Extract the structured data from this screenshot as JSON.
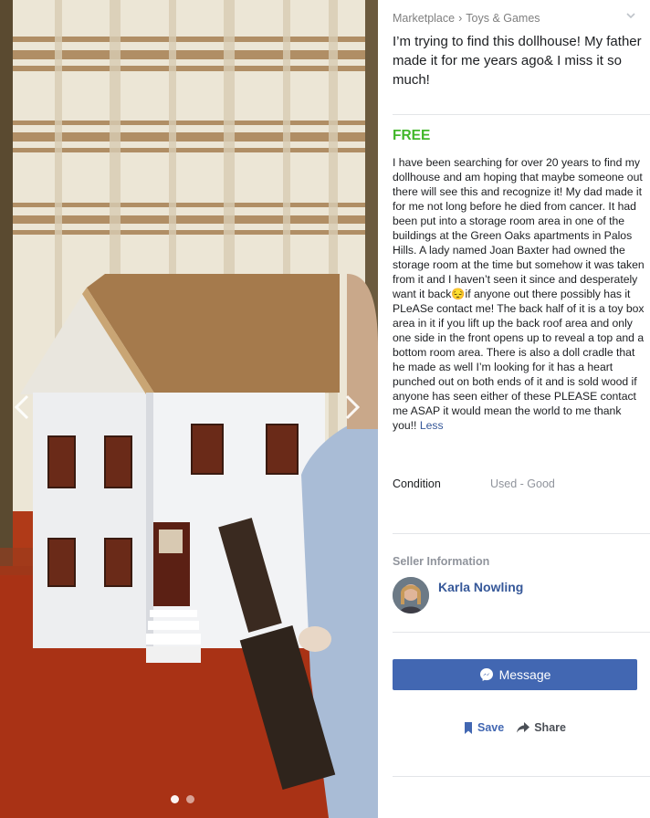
{
  "breadcrumb": {
    "section": "Marketplace",
    "separator": "›",
    "category": "Toys & Games"
  },
  "listing": {
    "title": "I’m trying to find this dollhouse! My father made it for me years ago& I miss it so much!",
    "price": "FREE",
    "description": "I have been searching for over 20 years to find my dollhouse and am hoping that maybe someone out there will see this and recognize it! My dad made it for me not long before he died from cancer. It had been put into a storage room area in one of the buildings at the Green Oaks apartments in Palos Hills. A lady named Joan Baxter had owned the storage room  at the time but somehow it was taken from it and I haven’t seen it since and desperately want it back😔if anyone out there possibly has it PLeASe contact me! The  back half of it is a toy box area in it if you lift up the back roof area and only one side in the front opens up to reveal a top and a bottom room area. There is also a doll cradle that he made as well I’m looking for it has a heart punched out on both ends of it and is sold wood if anyone has seen either of these PLEASE contact me ASAP it would mean the world to me thank you!!",
    "less_link": "Less",
    "condition_label": "Condition",
    "condition_value": "Used - Good"
  },
  "seller": {
    "heading": "Seller Information",
    "name": "Karla Nowling"
  },
  "buttons": {
    "message": "Message",
    "save": "Save",
    "share": "Share"
  },
  "gallery": {
    "image_count": 2,
    "current_index": 1
  },
  "colors": {
    "price": "#42b72a",
    "primary": "#4267b2",
    "link": "#365899",
    "muted": "#90949c"
  },
  "icons": [
    "chevron-left-icon",
    "chevron-right-icon",
    "chevron-down-icon",
    "messenger-icon",
    "bookmark-icon",
    "share-arrow-icon"
  ]
}
